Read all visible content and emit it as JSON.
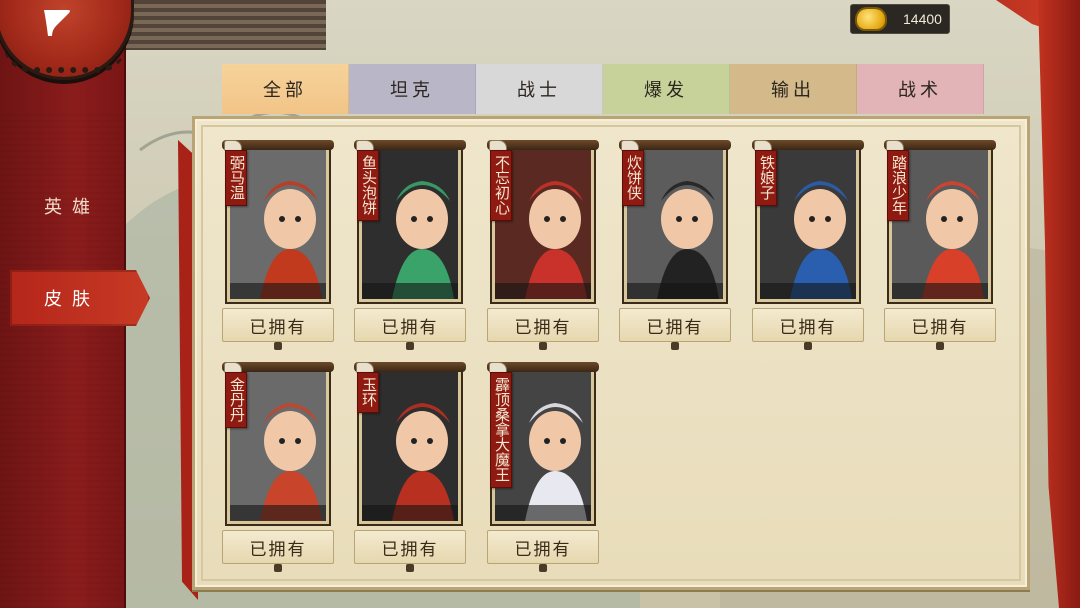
{
  "sidebar": {
    "back_icon": "back-arrow-icon",
    "items": [
      {
        "label": "英雄",
        "active": false
      },
      {
        "label": "皮肤",
        "active": true
      }
    ]
  },
  "currency": {
    "icon": "gold-ingot-icon",
    "value": "14400"
  },
  "tabs": [
    {
      "label": "全部",
      "color": "#f2c487",
      "active": true
    },
    {
      "label": "坦克",
      "color": "#b9b6c8"
    },
    {
      "label": "战士",
      "color": "#d8d8d8"
    },
    {
      "label": "爆发",
      "color": "#c6d29a"
    },
    {
      "label": "输出",
      "color": "#d4b98a"
    },
    {
      "label": "战术",
      "color": "#e2b4b8"
    }
  ],
  "cards": [
    {
      "name": "弼马温",
      "status": "已拥有",
      "bg": "#6b6b6b",
      "accent": "#c23a1e"
    },
    {
      "name": "鱼头泡饼",
      "status": "已拥有",
      "bg": "#2e2e2e",
      "accent": "#3aa36a"
    },
    {
      "name": "不忘初心",
      "status": "已拥有",
      "bg": "#5a2a22",
      "accent": "#c8322a"
    },
    {
      "name": "炊饼侠",
      "status": "已拥有",
      "bg": "#5c5c5c",
      "accent": "#222222"
    },
    {
      "name": "铁娘子",
      "status": "已拥有",
      "bg": "#3a3a3a",
      "accent": "#2a5fb0"
    },
    {
      "name": "踏浪少年",
      "status": "已拥有",
      "bg": "#5a5a5a",
      "accent": "#d8402a"
    },
    {
      "name": "金丹丹",
      "status": "已拥有",
      "bg": "#6a6a6a",
      "accent": "#c8442a"
    },
    {
      "name": "玉环",
      "status": "已拥有",
      "bg": "#2e2e2e",
      "accent": "#b83020"
    },
    {
      "name": "霹顶桑拿大魔王",
      "status": "已拥有",
      "bg": "#444444",
      "accent": "#e8e8f0"
    }
  ]
}
